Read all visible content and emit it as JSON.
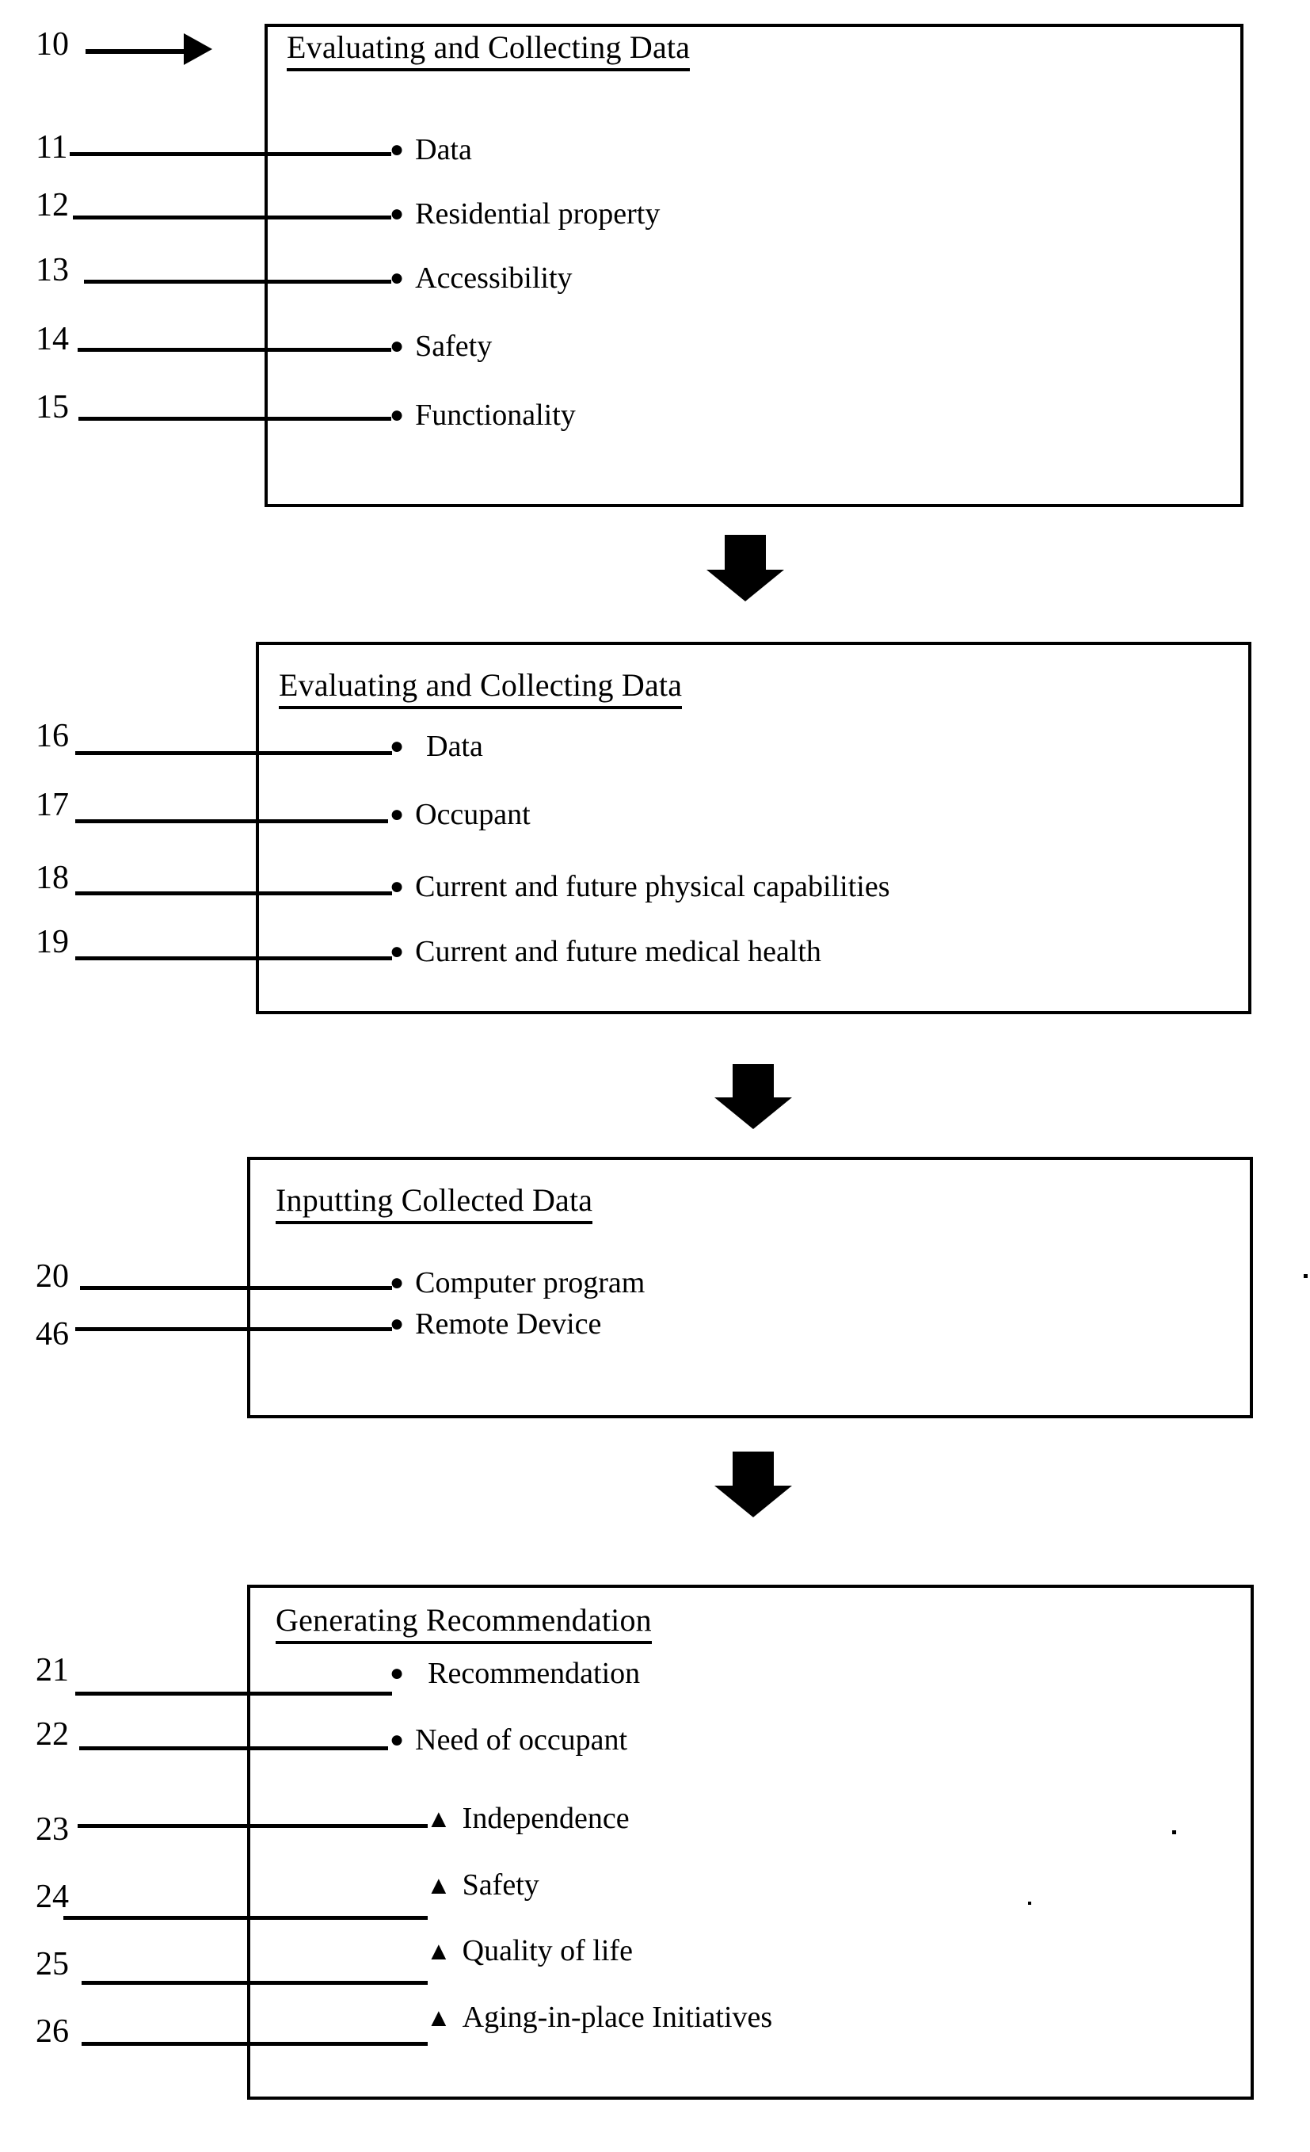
{
  "figure": {
    "type": "patent-flowchart",
    "background_color": "#ffffff",
    "line_color": "#000000"
  },
  "boxes": [
    {
      "id": "box1",
      "title": "Evaluating and Collecting Data",
      "items": [
        {
          "ref": "11",
          "marker": "●",
          "marker_name": "bullet",
          "label": "Data"
        },
        {
          "ref": "12",
          "marker": "●",
          "marker_name": "bullet",
          "label": "Residential property"
        },
        {
          "ref": "13",
          "marker": "●",
          "marker_name": "bullet",
          "label": "Accessibility"
        },
        {
          "ref": "14",
          "marker": "●",
          "marker_name": "bullet",
          "label": "Safety"
        },
        {
          "ref": "15",
          "marker": "●",
          "marker_name": "bullet",
          "label": "Functionality"
        }
      ]
    },
    {
      "id": "box2",
      "title": "Evaluating and Collecting Data",
      "items": [
        {
          "ref": "16",
          "marker": "●",
          "marker_name": "bullet",
          "label": "Data"
        },
        {
          "ref": "17",
          "marker": "●",
          "marker_name": "bullet",
          "label": "Occupant"
        },
        {
          "ref": "18",
          "marker": "●",
          "marker_name": "bullet",
          "label": "Current and future physical capabilities"
        },
        {
          "ref": "19",
          "marker": "●",
          "marker_name": "bullet",
          "label": "Current and future medical health"
        }
      ]
    },
    {
      "id": "box3",
      "title": "Inputting Collected Data",
      "items": [
        {
          "ref": "20",
          "marker": "●",
          "marker_name": "bullet",
          "label": "Computer program"
        },
        {
          "ref": "46",
          "marker": "●",
          "marker_name": "bullet",
          "label": "Remote Device"
        }
      ]
    },
    {
      "id": "box4",
      "title": "Generating Recommendation",
      "items": [
        {
          "ref": "21",
          "marker": "●",
          "marker_name": "bullet",
          "label": "Recommendation"
        },
        {
          "ref": "22",
          "marker": "●",
          "marker_name": "bullet",
          "label": "Need of occupant"
        },
        {
          "ref": "23",
          "marker": "▲",
          "marker_name": "triangle",
          "label": "Independence"
        },
        {
          "ref": "24",
          "marker": "▲",
          "marker_name": "triangle",
          "label": "Safety"
        },
        {
          "ref": "25",
          "marker": "▲",
          "marker_name": "triangle",
          "label": "Quality of life"
        },
        {
          "ref": "26",
          "marker": "▲",
          "marker_name": "triangle",
          "label": "Aging-in-place Initiatives"
        }
      ]
    }
  ],
  "entry_pointer": {
    "ref": "10",
    "target_box": "box1"
  },
  "connectors": [
    {
      "from": "box1",
      "to": "box2",
      "style": "block-arrow-down"
    },
    {
      "from": "box2",
      "to": "box3",
      "style": "block-arrow-down"
    },
    {
      "from": "box3",
      "to": "box4",
      "style": "block-arrow-down"
    }
  ]
}
